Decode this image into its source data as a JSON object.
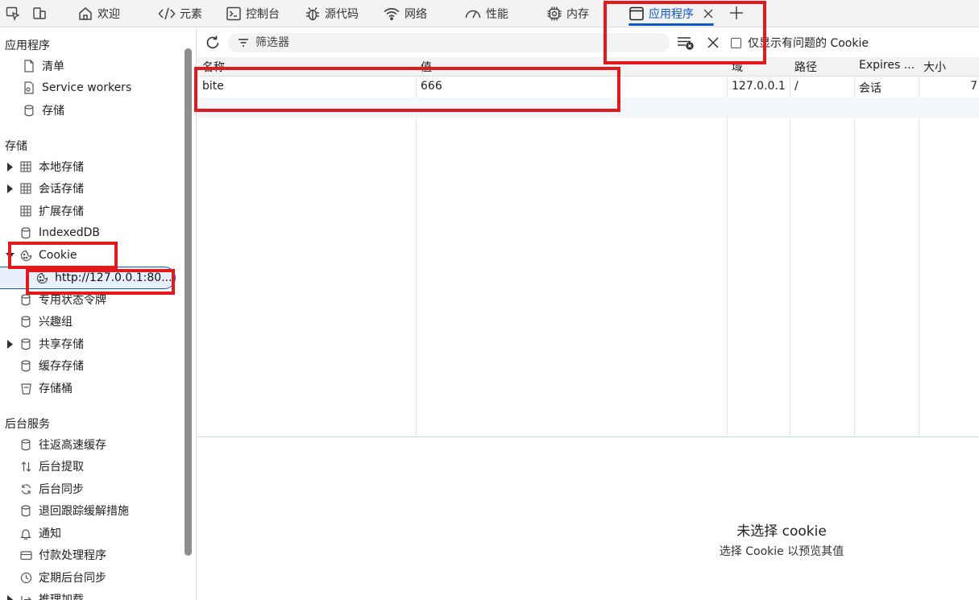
{
  "tabbar": {
    "tabs": [
      {
        "label": "欢迎",
        "icon": "home-icon"
      },
      {
        "label": "元素",
        "icon": "code-icon"
      },
      {
        "label": "控制台",
        "icon": "terminal-icon"
      },
      {
        "label": "源代码",
        "icon": "bug-icon"
      },
      {
        "label": "网络",
        "icon": "wifi-icon"
      },
      {
        "label": "性能",
        "icon": "gauge-icon"
      },
      {
        "label": "内存",
        "icon": "chip-icon"
      },
      {
        "label": "应用程序",
        "icon": "window-icon",
        "active": true
      }
    ]
  },
  "sidebar": {
    "app_section": {
      "title": "应用程序",
      "items": [
        {
          "label": "清单",
          "icon": "file-icon"
        },
        {
          "label": "Service workers",
          "icon": "gear-file-icon"
        },
        {
          "label": "存储",
          "icon": "database-icon"
        }
      ]
    },
    "storage_section": {
      "title": "存储",
      "items": [
        {
          "label": "本地存储",
          "icon": "grid-icon",
          "expandable": true
        },
        {
          "label": "会话存储",
          "icon": "grid-icon",
          "expandable": true
        },
        {
          "label": "扩展存储",
          "icon": "grid-icon"
        },
        {
          "label": "IndexedDB",
          "icon": "database-icon"
        },
        {
          "label": "Cookie",
          "icon": "cookie-icon",
          "expanded": true
        },
        {
          "label": "http://127.0.0.1:80...",
          "icon": "cookie-icon",
          "selected": true
        },
        {
          "label": "专用状态令牌",
          "icon": "database-icon"
        },
        {
          "label": "兴趣组",
          "icon": "database-icon"
        },
        {
          "label": "共享存储",
          "icon": "database-icon",
          "expandable": true
        },
        {
          "label": "缓存存储",
          "icon": "database-icon"
        },
        {
          "label": "存储桶",
          "icon": "bucket-icon"
        }
      ]
    },
    "bg_section": {
      "title": "后台服务",
      "items": [
        {
          "label": "往返高速缓存",
          "icon": "database-icon"
        },
        {
          "label": "后台提取",
          "icon": "arrows-updown-icon"
        },
        {
          "label": "后台同步",
          "icon": "sync-icon"
        },
        {
          "label": "退回跟踪缓解措施",
          "icon": "database-icon"
        },
        {
          "label": "通知",
          "icon": "bell-icon"
        },
        {
          "label": "付款处理程序",
          "icon": "card-icon"
        },
        {
          "label": "定期后台同步",
          "icon": "clock-icon"
        },
        {
          "label": "推理加载",
          "icon": "arrow-right-icon",
          "expandable": true
        }
      ]
    }
  },
  "toolbar": {
    "filter_placeholder": "筛选器",
    "issues_only_label": "仅显示有问题的 Cookie"
  },
  "cookie_table": {
    "columns": [
      "名称",
      "值",
      "域",
      "路径",
      "Expires ...",
      "大小"
    ],
    "rows": [
      [
        "bite",
        "666",
        "127.0.0.1",
        "/",
        "会话",
        "7"
      ]
    ]
  },
  "preview": {
    "title": "未选择 cookie",
    "subtitle": "选择 Cookie 以预览其值"
  },
  "colors": {
    "accent": "#0b57d0",
    "annotation": "#e3191b"
  }
}
